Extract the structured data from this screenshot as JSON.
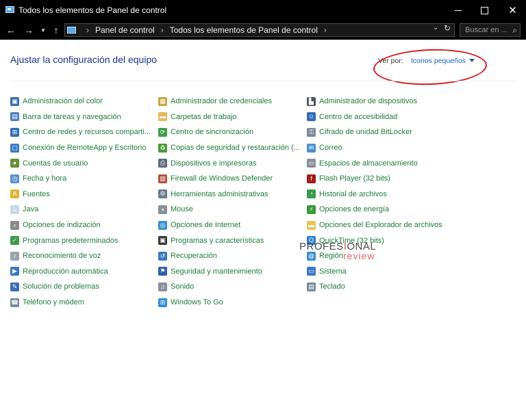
{
  "window": {
    "title": "Todos los elementos de Panel de control",
    "minimize_glyph": "",
    "close_glyph": "✕"
  },
  "nav": {
    "back_glyph": "←",
    "forward_glyph": "→",
    "recent_glyph": "▾",
    "up_glyph": "↑",
    "breadcrumbs": [
      "Panel de control",
      "Todos los elementos de Panel de control"
    ],
    "sep_glyph": "›",
    "dropdown_glyph": "⌄",
    "refresh_glyph": "↻",
    "search_placeholder": "Buscar en ...",
    "search_glyph": "⌕"
  },
  "content": {
    "heading": "Ajustar la configuración del equipo",
    "view_by_label": "Ver por:",
    "view_by_value": "Iconos pequeños"
  },
  "columns": [
    [
      {
        "label": "Administración del color",
        "icon": "color-management-icon",
        "color": "#3a6fb0",
        "glyph": "▣"
      },
      {
        "label": "Barra de tareas y navegación",
        "icon": "taskbar-icon",
        "color": "#4a7fc0",
        "glyph": "▤"
      },
      {
        "label": "Centro de redes y recursos comparti...",
        "icon": "network-center-icon",
        "color": "#2f6db5",
        "glyph": "⊞"
      },
      {
        "label": "Conexión de RemoteApp y Escritorio",
        "icon": "remoteapp-icon",
        "color": "#3b78c4",
        "glyph": "▢"
      },
      {
        "label": "Cuentas de usuario",
        "icon": "user-accounts-icon",
        "color": "#6b8e3a",
        "glyph": "●"
      },
      {
        "label": "Fecha y hora",
        "icon": "date-time-icon",
        "color": "#5b8fd0",
        "glyph": "◷"
      },
      {
        "label": "Fuentes",
        "icon": "fonts-icon",
        "color": "#e0b43a",
        "glyph": "A"
      },
      {
        "label": "Java",
        "icon": "java-icon",
        "color": "#c8d6e6",
        "glyph": "☕"
      },
      {
        "label": "Opciones de indización",
        "icon": "indexing-icon",
        "color": "#8a8a8a",
        "glyph": "⌕"
      },
      {
        "label": "Programas predeterminados",
        "icon": "default-programs-icon",
        "color": "#3a9a4a",
        "glyph": "✓"
      },
      {
        "label": "Reconocimiento de voz",
        "icon": "microphone-icon",
        "color": "#9aa3ad",
        "glyph": "♪"
      },
      {
        "label": "Reproducción automática",
        "icon": "autoplay-icon",
        "color": "#3b78c4",
        "glyph": "▶"
      },
      {
        "label": "Solución de problemas",
        "icon": "troubleshooting-icon",
        "color": "#3a6fb0",
        "glyph": "✎"
      },
      {
        "label": "Teléfono y módem",
        "icon": "phone-modem-icon",
        "color": "#7a8a9a",
        "glyph": "☎"
      }
    ],
    [
      {
        "label": "Administrador de credenciales",
        "icon": "credential-manager-icon",
        "color": "#c9a640",
        "glyph": "▦"
      },
      {
        "label": "Carpetas de trabajo",
        "icon": "work-folders-icon",
        "color": "#e6b85a",
        "glyph": "▬"
      },
      {
        "label": "Centro de sincronización",
        "icon": "sync-center-icon",
        "color": "#3aa04a",
        "glyph": "⟳"
      },
      {
        "label": "Copias de seguridad y restauración (...",
        "icon": "backup-icon",
        "color": "#4a9a3a",
        "glyph": "♻"
      },
      {
        "label": "Dispositivos e impresoras",
        "icon": "devices-printers-icon",
        "color": "#5a6a7a",
        "glyph": "⎙"
      },
      {
        "label": "Firewall de Windows Defender",
        "icon": "firewall-icon",
        "color": "#b5503a",
        "glyph": "▥"
      },
      {
        "label": "Herramientas administrativas",
        "icon": "admin-tools-icon",
        "color": "#6a7a8a",
        "glyph": "⚙"
      },
      {
        "label": "Mouse",
        "icon": "mouse-icon",
        "color": "#8a9099",
        "glyph": "◖"
      },
      {
        "label": "Opciones de Internet",
        "icon": "internet-options-icon",
        "color": "#3a8fd0",
        "glyph": "◎"
      },
      {
        "label": "Programas y características",
        "icon": "programs-features-icon",
        "color": "#3a3a3a",
        "glyph": "▣"
      },
      {
        "label": "Recuperación",
        "icon": "recovery-icon",
        "color": "#3a78c4",
        "glyph": "↺"
      },
      {
        "label": "Seguridad y mantenimiento",
        "icon": "flag-icon",
        "color": "#2f5fa8",
        "glyph": "⚑"
      },
      {
        "label": "Sonido",
        "icon": "sound-icon",
        "color": "#8a9099",
        "glyph": "♫"
      },
      {
        "label": "Windows To Go",
        "icon": "windows-to-go-icon",
        "color": "#2f8fd8",
        "glyph": "⊞"
      }
    ],
    [
      {
        "label": "Administrador de dispositivos",
        "icon": "device-manager-icon",
        "color": "#4a5560",
        "glyph": "▙"
      },
      {
        "label": "Centro de accesibilidad",
        "icon": "accessibility-icon",
        "color": "#2f6db5",
        "glyph": "☺"
      },
      {
        "label": "Cifrado de unidad BitLocker",
        "icon": "bitlocker-icon",
        "color": "#7a8a9a",
        "glyph": "⚿"
      },
      {
        "label": "Correo",
        "icon": "mail-icon",
        "color": "#4a8fd0",
        "glyph": "✉"
      },
      {
        "label": "Espacios de almacenamiento",
        "icon": "storage-spaces-icon",
        "color": "#8a9099",
        "glyph": "▭"
      },
      {
        "label": "Flash Player (32 bits)",
        "icon": "flash-player-icon",
        "color": "#a01e1e",
        "glyph": "f"
      },
      {
        "label": "Historial de archivos",
        "icon": "file-history-icon",
        "color": "#3a9a4a",
        "glyph": "◔"
      },
      {
        "label": "Opciones de energía",
        "icon": "power-options-icon",
        "color": "#3a9a3a",
        "glyph": "⚡"
      },
      {
        "label": "Opciones del Explorador de archivos",
        "icon": "explorer-options-icon",
        "color": "#e6c35a",
        "glyph": "▬"
      },
      {
        "label": "QuickTime (32 bits)",
        "icon": "quicktime-icon",
        "color": "#2f7fd0",
        "glyph": "Q"
      },
      {
        "label": "Región",
        "icon": "region-icon",
        "color": "#3a8fd0",
        "glyph": "◍"
      },
      {
        "label": "Sistema",
        "icon": "system-icon",
        "color": "#3a78c4",
        "glyph": "▭"
      },
      {
        "label": "Teclado",
        "icon": "keyboard-icon",
        "color": "#7a8a9a",
        "glyph": "▤"
      }
    ]
  ],
  "watermark": {
    "text_before": "PROFES",
    "text_accent": "I",
    "text_after": "ONAL",
    "subtext": "review"
  }
}
